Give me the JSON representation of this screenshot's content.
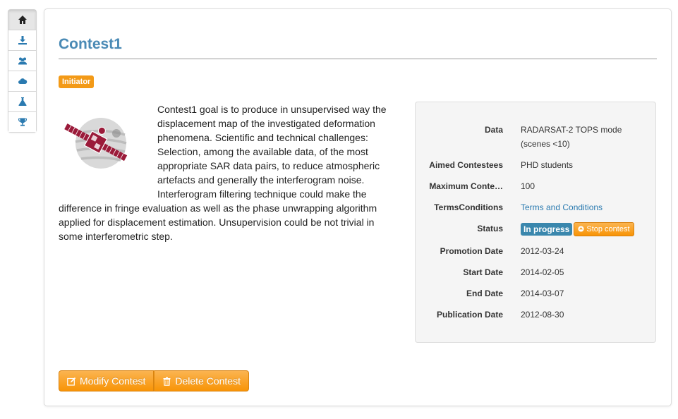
{
  "nav": {
    "items": [
      {
        "icon": "home-icon"
      },
      {
        "icon": "download-icon"
      },
      {
        "icon": "users-icon"
      },
      {
        "icon": "cloud-icon"
      },
      {
        "icon": "flask-icon"
      },
      {
        "icon": "trophy-icon"
      }
    ]
  },
  "contest": {
    "title": "Contest1",
    "role_badge": "Initiator",
    "description": "Contest1 goal is to produce in unsupervised way the displacement map of the investigated deformation phenomena. Scientific and technical challenges: Selection, among the available data, of the most appropriate SAR data pairs, to reduce atmospheric artefacts and generally the interferogram noise. Interferogram filtering technique could make the difference in fringe evaluation as well as the phase unwrapping algorithm applied for displacement estimation. Unsupervision could be not trivial in some interferometric step."
  },
  "info": {
    "data_label": "Data",
    "data_value": "RADARSAT-2 TOPS mode (scenes <10)",
    "aimed_label": "Aimed Contestees",
    "aimed_value": "PHD students",
    "max_label": "Maximum Conte…",
    "max_value": "100",
    "terms_label": "TermsConditions",
    "terms_value": "Terms and Conditions",
    "status_label": "Status",
    "status_value": "In progress",
    "stop_label": "Stop contest",
    "promotion_label": "Promotion Date",
    "promotion_value": "2012-03-24",
    "start_label": "Start Date",
    "start_value": "2014-02-05",
    "end_label": "End Date",
    "end_value": "2014-03-07",
    "publication_label": "Publication Date",
    "publication_value": "2012-08-30"
  },
  "actions": {
    "modify_label": "Modify Contest",
    "delete_label": "Delete Contest"
  },
  "colors": {
    "title": "#4a8ab5",
    "accent_orange": "#f89406",
    "status_blue": "#3a87ad",
    "satellite_red": "#9b1b3a"
  }
}
